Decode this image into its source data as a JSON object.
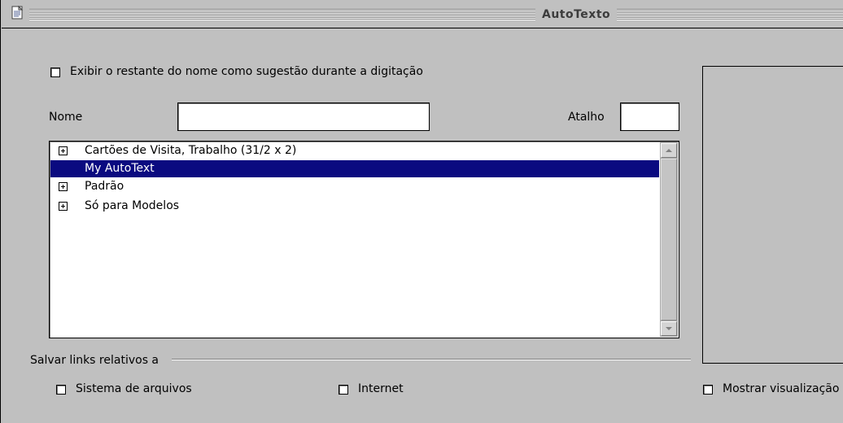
{
  "window": {
    "title": "AutoTexto",
    "icon": "document-icon"
  },
  "options": {
    "suggest_checkbox_label": "Exibir o restante do nome como sugestão durante a digitação",
    "suggest_checked": false
  },
  "name_field": {
    "label": "Nome",
    "value": ""
  },
  "shortcut_field": {
    "label": "Atalho",
    "value": ""
  },
  "category_list": {
    "items": [
      {
        "label": "Cartões de Visita, Trabalho (31/2 x 2)",
        "expandable": true,
        "selected": false
      },
      {
        "label": "My AutoText",
        "expandable": false,
        "selected": true
      },
      {
        "label": "Padrão",
        "expandable": true,
        "selected": false
      },
      {
        "label": "Só para Modelos",
        "expandable": true,
        "selected": false
      }
    ]
  },
  "links_section": {
    "title": "Salvar links relativos a",
    "filesystem_label": "Sistema de arquivos",
    "filesystem_checked": false,
    "internet_label": "Internet",
    "internet_checked": false
  },
  "preview": {
    "show_preview_label": "Mostrar visualização",
    "show_preview_checked": false
  }
}
